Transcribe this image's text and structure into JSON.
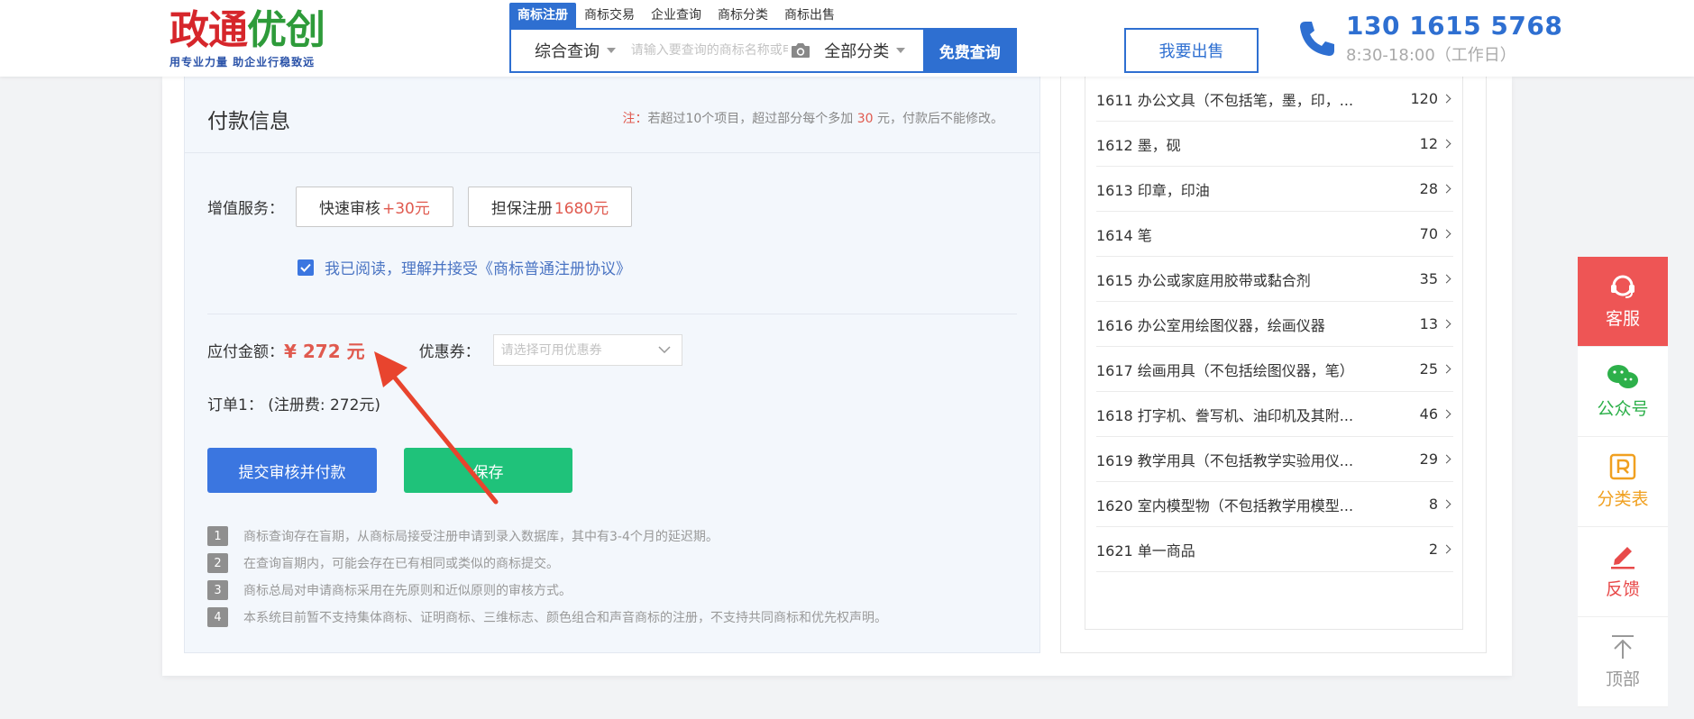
{
  "logo": {
    "title_part1": "政通",
    "title_part2": "优创",
    "slogan": "用专业力量 助企业行稳致远"
  },
  "search": {
    "tabs": [
      "商标注册",
      "商标交易",
      "企业查询",
      "商标分类",
      "商标出售"
    ],
    "active_tab": 0,
    "type_label": "综合查询",
    "placeholder": "请输入要查询的商标名称或申请号",
    "category_label": "全部分类",
    "search_button": "免费查询"
  },
  "sell_button": "我要出售",
  "contact": {
    "phone": "130 1615 5768",
    "hours": "8:30-18:00（工作日）"
  },
  "payment": {
    "title": "付款信息",
    "note_prefix": "注：",
    "note_text1": "若超过10个项目，超过部分每个多加 ",
    "note_amount": "30",
    "note_text2": " 元，付款后不能修改。",
    "service_label": "增值服务：",
    "service1_label": "快速审核 ",
    "service1_price": "+30元",
    "service2_label": "担保注册 ",
    "service2_price": "1680元",
    "agreement": "我已阅读，理解并接受《商标普通注册协议》",
    "amount_label": "应付金额：",
    "amount_value": "¥ 272 元",
    "coupon_label": "优惠券：",
    "coupon_placeholder": "请选择可用优惠券",
    "order_line": "订单1：  (注册费: 272元)",
    "submit_button": "提交审核并付款",
    "save_button": "保存",
    "tips": [
      "商标查询存在盲期，从商标局接受注册申请到录入数据库，其中有3-4个月的延迟期。",
      "在查询盲期内，可能会存在已有相同或类似的商标提交。",
      "商标总局对申请商标采用在先原则和近似原则的审核方式。",
      "本系统目前暂不支持集体商标、证明商标、三维标志、颜色组合和声音商标的注册，不支持共同商标和优先权声明。"
    ]
  },
  "categories": [
    {
      "name": "1611 办公文具（不包括笔，墨，印，...",
      "count": "120"
    },
    {
      "name": "1612 墨，砚",
      "count": "12"
    },
    {
      "name": "1613 印章，印油",
      "count": "28"
    },
    {
      "name": "1614 笔",
      "count": "70"
    },
    {
      "name": "1615 办公或家庭用胶带或黏合剂",
      "count": "35"
    },
    {
      "name": "1616 办公室用绘图仪器，绘画仪器",
      "count": "13"
    },
    {
      "name": "1617 绘画用具（不包括绘图仪器，笔）",
      "count": "25"
    },
    {
      "name": "1618 打字机、誊写机、油印机及其附...",
      "count": "46"
    },
    {
      "name": "1619 教学用具（不包括教学实验用仪...",
      "count": "29"
    },
    {
      "name": "1620 室内模型物（不包括教学用模型...",
      "count": "8"
    },
    {
      "name": "1621 单一商品",
      "count": "2"
    }
  ],
  "sidebar": {
    "items": [
      "客服",
      "公众号",
      "分类表",
      "反馈",
      "顶部"
    ]
  },
  "colors": {
    "primary": "#2e6fd1",
    "accent_red": "#e05a4f",
    "save_green": "#1fc27a",
    "service_red": "#ee5555"
  }
}
